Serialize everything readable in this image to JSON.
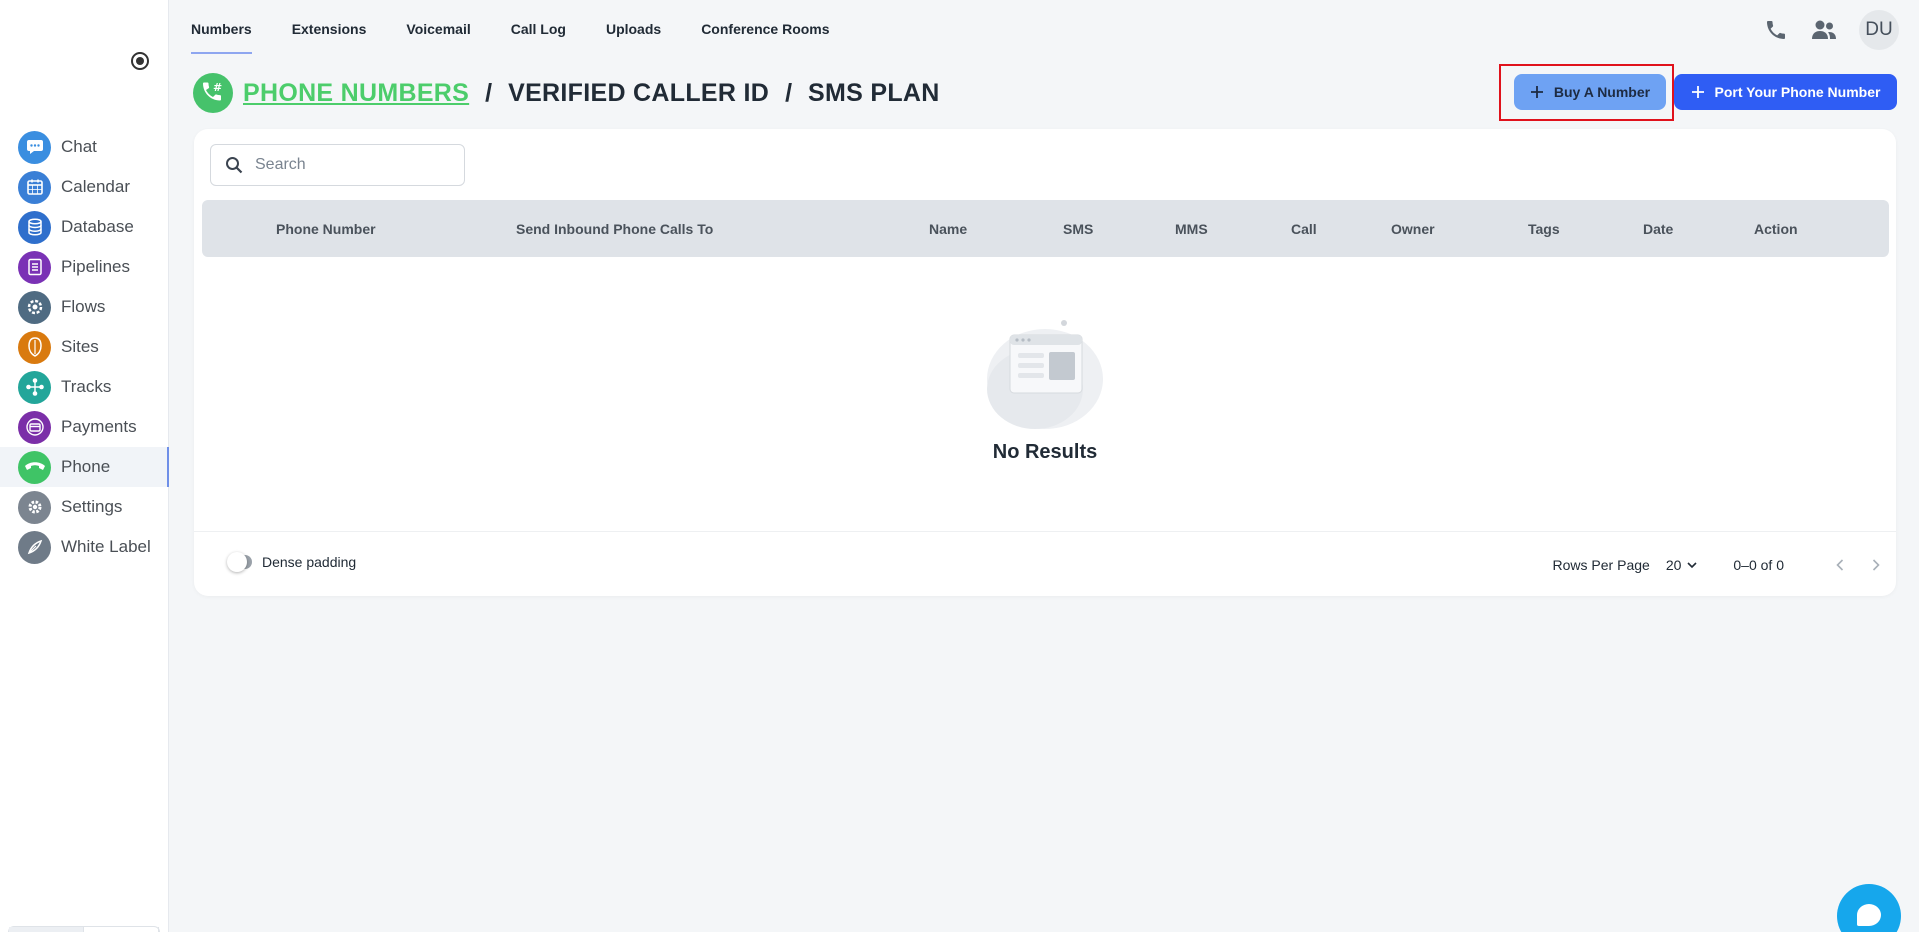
{
  "tabs": [
    {
      "label": "Numbers",
      "active": true
    },
    {
      "label": "Extensions"
    },
    {
      "label": "Voicemail"
    },
    {
      "label": "Call Log"
    },
    {
      "label": "Uploads"
    },
    {
      "label": "Conference Rooms"
    }
  ],
  "user": {
    "initials": "DU"
  },
  "sidebar": {
    "items": [
      {
        "label": "Chat",
        "icon": "chat-icon",
        "color": "#3a8ee0"
      },
      {
        "label": "Calendar",
        "icon": "calendar-icon",
        "color": "#3a7fd6"
      },
      {
        "label": "Database",
        "icon": "database-icon",
        "color": "#2f6fcc"
      },
      {
        "label": "Pipelines",
        "icon": "pipelines-icon",
        "color": "#7a32b5"
      },
      {
        "label": "Flows",
        "icon": "flows-icon",
        "color": "#4f6b82"
      },
      {
        "label": "Sites",
        "icon": "sites-icon",
        "color": "#d97a0f"
      },
      {
        "label": "Tracks",
        "icon": "tracks-icon",
        "color": "#23a69a"
      },
      {
        "label": "Payments",
        "icon": "payments-icon",
        "color": "#7b2fa8"
      },
      {
        "label": "Phone",
        "icon": "phone-icon",
        "color": "#3fc466",
        "active": true
      },
      {
        "label": "Settings",
        "icon": "settings-icon",
        "color": "#7c8590"
      },
      {
        "label": "White Label",
        "icon": "white-label-icon",
        "color": "#6f7b88"
      }
    ]
  },
  "header": {
    "crumbs": [
      "PHONE NUMBERS",
      "VERIFIED CALLER ID",
      "SMS PLAN"
    ],
    "separator": "/",
    "accent": "#4ccd6b"
  },
  "buttons": {
    "buy": "Buy A Number",
    "port": "Port Your Phone Number"
  },
  "search": {
    "placeholder": "Search"
  },
  "table": {
    "columns": [
      "Phone Number",
      "Send Inbound Phone Calls To",
      "Name",
      "SMS",
      "MMS",
      "Call",
      "Owner",
      "Tags",
      "Date",
      "Action"
    ],
    "rows": [],
    "empty_text": "No Results"
  },
  "footer": {
    "dense_label": "Dense padding",
    "rows_per_page_label": "Rows Per Page",
    "rows_per_page": "20",
    "range": "0–0 of 0"
  }
}
